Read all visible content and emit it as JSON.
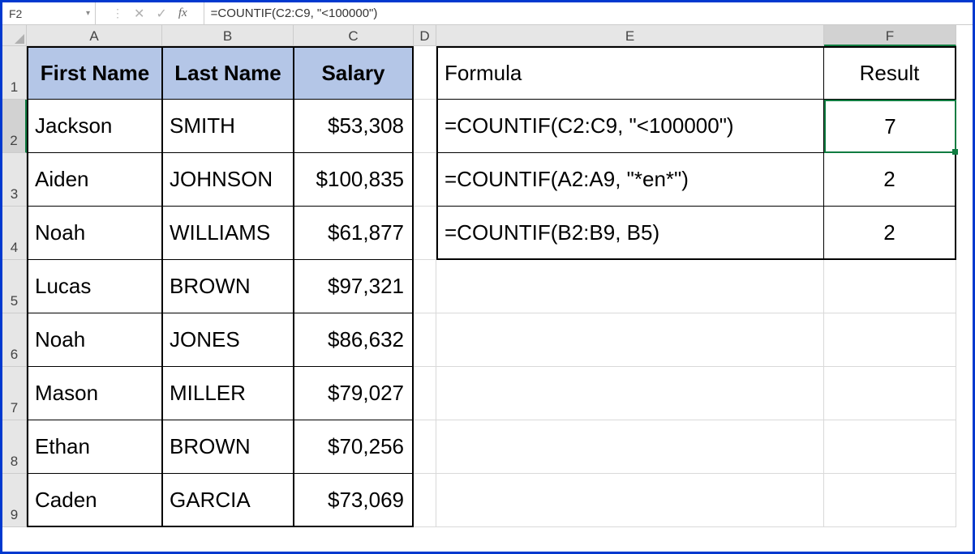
{
  "namebox": "F2",
  "formula_bar": "=COUNTIF(C2:C9, \"<100000\")",
  "columns": [
    "A",
    "B",
    "C",
    "D",
    "E",
    "F"
  ],
  "headers": {
    "A": "First Name",
    "B": "Last Name",
    "C": "Salary",
    "E": "Formula",
    "F": "Result"
  },
  "data": {
    "r2": {
      "A": "Jackson",
      "B": "SMITH",
      "C": "$53,308",
      "E": "=COUNTIF(C2:C9, \"<100000\")",
      "F": "7"
    },
    "r3": {
      "A": "Aiden",
      "B": "JOHNSON",
      "C": "$100,835",
      "E": "=COUNTIF(A2:A9, \"*en*\")",
      "F": "2"
    },
    "r4": {
      "A": "Noah",
      "B": "WILLIAMS",
      "C": "$61,877",
      "E": "=COUNTIF(B2:B9, B5)",
      "F": "2"
    },
    "r5": {
      "A": "Lucas",
      "B": "BROWN",
      "C": "$97,321"
    },
    "r6": {
      "A": "Noah",
      "B": "JONES",
      "C": "$86,632"
    },
    "r7": {
      "A": "Mason",
      "B": "MILLER",
      "C": "$79,027"
    },
    "r8": {
      "A": "Ethan",
      "B": "BROWN",
      "C": "$70,256"
    },
    "r9": {
      "A": "Caden",
      "B": "GARCIA",
      "C": "$73,069"
    }
  },
  "chart_data": {
    "type": "table",
    "tables": [
      {
        "columns": [
          "First Name",
          "Last Name",
          "Salary"
        ],
        "rows": [
          [
            "Jackson",
            "SMITH",
            53308
          ],
          [
            "Aiden",
            "JOHNSON",
            100835
          ],
          [
            "Noah",
            "WILLIAMS",
            61877
          ],
          [
            "Lucas",
            "BROWN",
            97321
          ],
          [
            "Noah",
            "JONES",
            86632
          ],
          [
            "Mason",
            "MILLER",
            79027
          ],
          [
            "Ethan",
            "BROWN",
            70256
          ],
          [
            "Caden",
            "GARCIA",
            73069
          ]
        ]
      },
      {
        "columns": [
          "Formula",
          "Result"
        ],
        "rows": [
          [
            "=COUNTIF(C2:C9, \"<100000\")",
            7
          ],
          [
            "=COUNTIF(A2:A9, \"*en*\")",
            2
          ],
          [
            "=COUNTIF(B2:B9, B5)",
            2
          ]
        ]
      }
    ]
  }
}
